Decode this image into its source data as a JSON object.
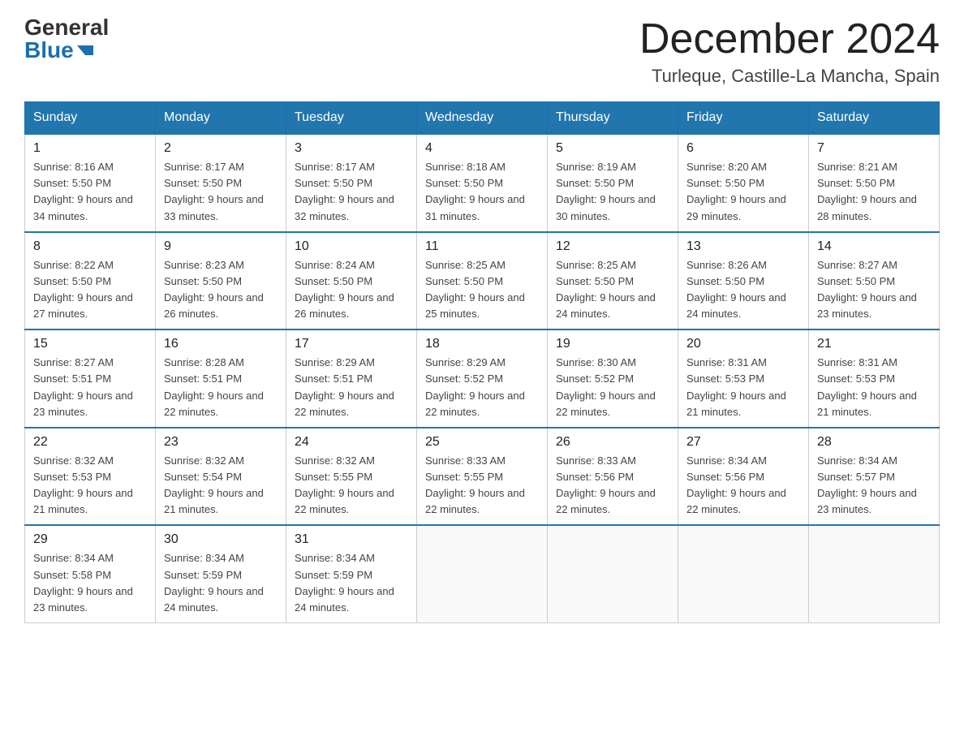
{
  "header": {
    "logo_general": "General",
    "logo_blue": "Blue",
    "month_title": "December 2024",
    "location": "Turleque, Castille-La Mancha, Spain"
  },
  "days_of_week": [
    "Sunday",
    "Monday",
    "Tuesday",
    "Wednesday",
    "Thursday",
    "Friday",
    "Saturday"
  ],
  "weeks": [
    [
      {
        "day": "1",
        "sunrise": "8:16 AM",
        "sunset": "5:50 PM",
        "daylight": "9 hours and 34 minutes."
      },
      {
        "day": "2",
        "sunrise": "8:17 AM",
        "sunset": "5:50 PM",
        "daylight": "9 hours and 33 minutes."
      },
      {
        "day": "3",
        "sunrise": "8:17 AM",
        "sunset": "5:50 PM",
        "daylight": "9 hours and 32 minutes."
      },
      {
        "day": "4",
        "sunrise": "8:18 AM",
        "sunset": "5:50 PM",
        "daylight": "9 hours and 31 minutes."
      },
      {
        "day": "5",
        "sunrise": "8:19 AM",
        "sunset": "5:50 PM",
        "daylight": "9 hours and 30 minutes."
      },
      {
        "day": "6",
        "sunrise": "8:20 AM",
        "sunset": "5:50 PM",
        "daylight": "9 hours and 29 minutes."
      },
      {
        "day": "7",
        "sunrise": "8:21 AM",
        "sunset": "5:50 PM",
        "daylight": "9 hours and 28 minutes."
      }
    ],
    [
      {
        "day": "8",
        "sunrise": "8:22 AM",
        "sunset": "5:50 PM",
        "daylight": "9 hours and 27 minutes."
      },
      {
        "day": "9",
        "sunrise": "8:23 AM",
        "sunset": "5:50 PM",
        "daylight": "9 hours and 26 minutes."
      },
      {
        "day": "10",
        "sunrise": "8:24 AM",
        "sunset": "5:50 PM",
        "daylight": "9 hours and 26 minutes."
      },
      {
        "day": "11",
        "sunrise": "8:25 AM",
        "sunset": "5:50 PM",
        "daylight": "9 hours and 25 minutes."
      },
      {
        "day": "12",
        "sunrise": "8:25 AM",
        "sunset": "5:50 PM",
        "daylight": "9 hours and 24 minutes."
      },
      {
        "day": "13",
        "sunrise": "8:26 AM",
        "sunset": "5:50 PM",
        "daylight": "9 hours and 24 minutes."
      },
      {
        "day": "14",
        "sunrise": "8:27 AM",
        "sunset": "5:50 PM",
        "daylight": "9 hours and 23 minutes."
      }
    ],
    [
      {
        "day": "15",
        "sunrise": "8:27 AM",
        "sunset": "5:51 PM",
        "daylight": "9 hours and 23 minutes."
      },
      {
        "day": "16",
        "sunrise": "8:28 AM",
        "sunset": "5:51 PM",
        "daylight": "9 hours and 22 minutes."
      },
      {
        "day": "17",
        "sunrise": "8:29 AM",
        "sunset": "5:51 PM",
        "daylight": "9 hours and 22 minutes."
      },
      {
        "day": "18",
        "sunrise": "8:29 AM",
        "sunset": "5:52 PM",
        "daylight": "9 hours and 22 minutes."
      },
      {
        "day": "19",
        "sunrise": "8:30 AM",
        "sunset": "5:52 PM",
        "daylight": "9 hours and 22 minutes."
      },
      {
        "day": "20",
        "sunrise": "8:31 AM",
        "sunset": "5:53 PM",
        "daylight": "9 hours and 21 minutes."
      },
      {
        "day": "21",
        "sunrise": "8:31 AM",
        "sunset": "5:53 PM",
        "daylight": "9 hours and 21 minutes."
      }
    ],
    [
      {
        "day": "22",
        "sunrise": "8:32 AM",
        "sunset": "5:53 PM",
        "daylight": "9 hours and 21 minutes."
      },
      {
        "day": "23",
        "sunrise": "8:32 AM",
        "sunset": "5:54 PM",
        "daylight": "9 hours and 21 minutes."
      },
      {
        "day": "24",
        "sunrise": "8:32 AM",
        "sunset": "5:55 PM",
        "daylight": "9 hours and 22 minutes."
      },
      {
        "day": "25",
        "sunrise": "8:33 AM",
        "sunset": "5:55 PM",
        "daylight": "9 hours and 22 minutes."
      },
      {
        "day": "26",
        "sunrise": "8:33 AM",
        "sunset": "5:56 PM",
        "daylight": "9 hours and 22 minutes."
      },
      {
        "day": "27",
        "sunrise": "8:34 AM",
        "sunset": "5:56 PM",
        "daylight": "9 hours and 22 minutes."
      },
      {
        "day": "28",
        "sunrise": "8:34 AM",
        "sunset": "5:57 PM",
        "daylight": "9 hours and 23 minutes."
      }
    ],
    [
      {
        "day": "29",
        "sunrise": "8:34 AM",
        "sunset": "5:58 PM",
        "daylight": "9 hours and 23 minutes."
      },
      {
        "day": "30",
        "sunrise": "8:34 AM",
        "sunset": "5:59 PM",
        "daylight": "9 hours and 24 minutes."
      },
      {
        "day": "31",
        "sunrise": "8:34 AM",
        "sunset": "5:59 PM",
        "daylight": "9 hours and 24 minutes."
      },
      null,
      null,
      null,
      null
    ]
  ]
}
